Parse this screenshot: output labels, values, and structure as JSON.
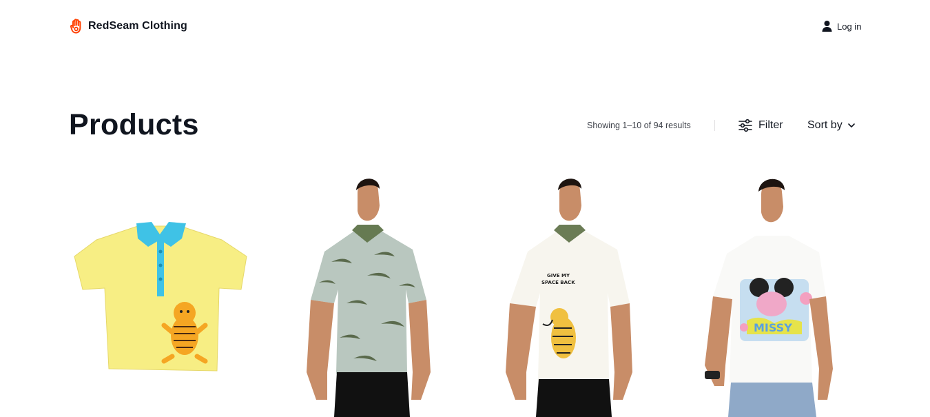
{
  "header": {
    "brand": "RedSeam Clothing",
    "logo_icon": "hand-icon",
    "login_label": "Log in",
    "login_icon": "user-icon"
  },
  "main": {
    "title": "Products",
    "results_text": "Showing 1–10 of 94 results",
    "filter_label": "Filter",
    "filter_icon": "sliders-icon",
    "sort_label": "Sort by",
    "sort_icon": "chevron-down-icon"
  },
  "products": [
    {
      "image": "yellow polo shirt with tigger print"
    },
    {
      "image": "model in camouflage polo shirt"
    },
    {
      "image": "model in white tiger print polo shirt"
    },
    {
      "image": "model in white mickey print t-shirt"
    }
  ],
  "colors": {
    "accent": "#ff4000",
    "text": "#10151f",
    "muted": "#3e424a"
  }
}
